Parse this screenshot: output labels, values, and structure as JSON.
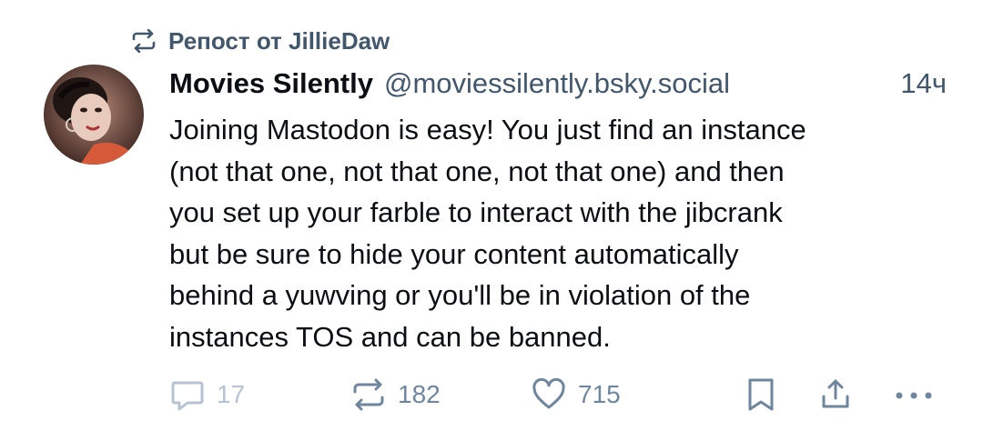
{
  "repost": {
    "label": "Репост от JillieDaw",
    "icon": "repost-icon"
  },
  "author": {
    "display_name": "Movies Silently",
    "handle": "@moviessilently.bsky.social",
    "avatar_icon": "avatar-illustration"
  },
  "timestamp": "14ч",
  "text_lines": [
    "Joining Mastodon is easy! You just find an instance",
    "(not that one, not that one, not that one) and then",
    "you set up your farble to interact with the jibcrank",
    "but be sure to hide your content automatically",
    "behind a yuwving or you'll be in violation of the",
    "instances TOS and can be banned."
  ],
  "actions": {
    "reply": {
      "icon": "reply-icon",
      "count": "17"
    },
    "repost": {
      "icon": "repost-icon",
      "count": "182"
    },
    "like": {
      "icon": "heart-icon",
      "count": "715"
    },
    "bookmark": {
      "icon": "bookmark-icon"
    },
    "share": {
      "icon": "share-icon"
    },
    "more": {
      "icon": "more-icon"
    }
  },
  "colors": {
    "text_primary": "#0b0f14",
    "text_secondary": "#42576c",
    "icon_muted": "#6f869f",
    "icon_disabled": "#b6c3d2",
    "background": "#ffffff"
  }
}
